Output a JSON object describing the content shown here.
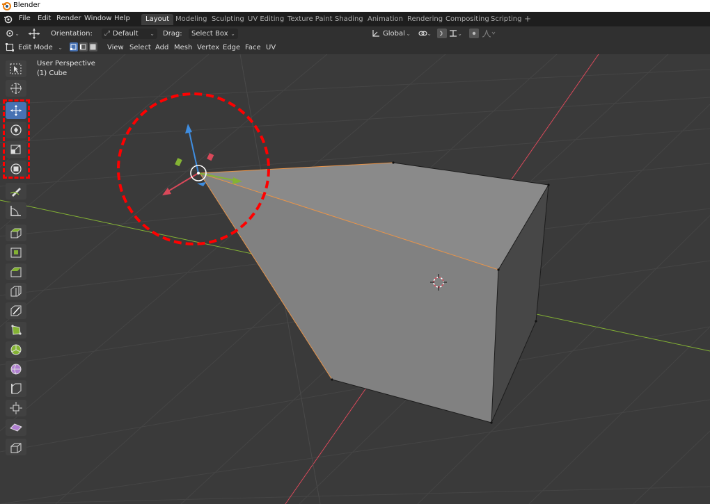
{
  "window": {
    "title": "Blender"
  },
  "menu": [
    "File",
    "Edit",
    "Render",
    "Window",
    "Help"
  ],
  "workspaces": [
    {
      "label": "Layout",
      "active": true
    },
    {
      "label": "Modeling",
      "active": false
    },
    {
      "label": "Sculpting",
      "active": false
    },
    {
      "label": "UV Editing",
      "active": false
    },
    {
      "label": "Texture Paint",
      "active": false
    },
    {
      "label": "Shading",
      "active": false
    },
    {
      "label": "Animation",
      "active": false
    },
    {
      "label": "Rendering",
      "active": false
    },
    {
      "label": "Compositing",
      "active": false
    },
    {
      "label": "Scripting",
      "active": false
    }
  ],
  "add_workspace": "+",
  "tool_header": {
    "orientation_label": "Orientation:",
    "orientation_value": "Default",
    "drag_label": "Drag:",
    "drag_value": "Select Box",
    "transform_orientation": "Global"
  },
  "editor_header": {
    "mode": "Edit Mode",
    "menus": [
      "View",
      "Select",
      "Add",
      "Mesh",
      "Vertex",
      "Edge",
      "Face",
      "UV"
    ]
  },
  "viewport": {
    "view_name": "User Perspective",
    "object_name": "(1) Cube"
  },
  "tools": [
    {
      "name": "select-box-tool",
      "icon": "select-box-icon",
      "active": false
    },
    {
      "name": "cursor-tool",
      "icon": "cursor-icon",
      "active": false
    },
    {
      "name": "move-tool",
      "icon": "move-icon",
      "active": true
    },
    {
      "name": "rotate-tool",
      "icon": "rotate-icon",
      "active": false
    },
    {
      "name": "scale-tool",
      "icon": "scale-icon",
      "active": false
    },
    {
      "name": "transform-tool",
      "icon": "transform-icon",
      "active": false
    },
    {
      "name": "annotate-tool",
      "icon": "annotate-icon",
      "active": false
    },
    {
      "name": "measure-tool",
      "icon": "measure-icon",
      "active": false
    },
    {
      "name": "extrude-region-tool",
      "icon": "extrude-icon",
      "active": false
    },
    {
      "name": "inset-faces-tool",
      "icon": "inset-icon",
      "active": false
    },
    {
      "name": "bevel-tool",
      "icon": "bevel-icon",
      "active": false
    },
    {
      "name": "loop-cut-tool",
      "icon": "loop-cut-icon",
      "active": false
    },
    {
      "name": "knife-tool",
      "icon": "knife-icon",
      "active": false
    },
    {
      "name": "poly-build-tool",
      "icon": "poly-build-icon",
      "active": false
    },
    {
      "name": "spin-tool",
      "icon": "spin-icon",
      "active": false
    },
    {
      "name": "smooth-tool",
      "icon": "smooth-icon",
      "active": false
    },
    {
      "name": "edge-slide-tool",
      "icon": "edge-slide-icon",
      "active": false
    },
    {
      "name": "shrink-fatten-tool",
      "icon": "shrink-fatten-icon",
      "active": false
    },
    {
      "name": "shear-tool",
      "icon": "shear-icon",
      "active": false
    },
    {
      "name": "rip-region-tool",
      "icon": "rip-icon",
      "active": false
    }
  ],
  "colors": {
    "active_tool": "#4772b3",
    "annotation": "#ff0000",
    "x_axis": "#d9495a",
    "y_axis": "#84b334",
    "z_axis": "#3f8de0"
  }
}
